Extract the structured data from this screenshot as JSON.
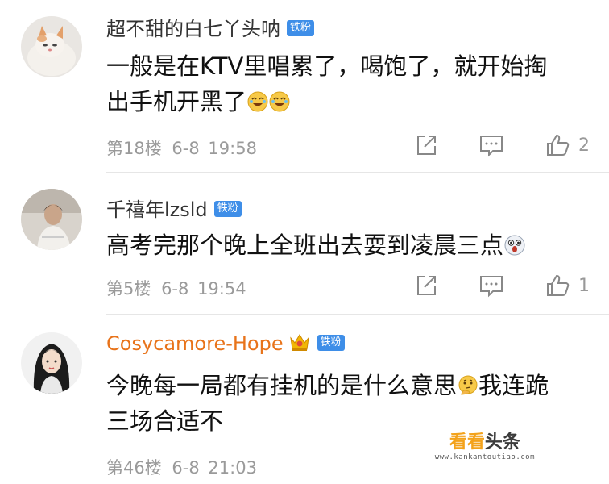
{
  "comments": [
    {
      "username": "超不甜的白七丫头呐",
      "badge": "铁粉",
      "text_line1": "一般是在KTV里唱累了，喝饱了，就开始掏",
      "text_line2": "出手机开黑了",
      "floor": "第18楼",
      "date": "6-8",
      "time": "19:58",
      "like_count": "2"
    },
    {
      "username": "千禧年lzsld",
      "badge": "铁粉",
      "text_line1": "高考完那个晚上全班出去耍到凌晨三点",
      "floor": "第5楼",
      "date": "6-8",
      "time": "19:54",
      "like_count": "1"
    },
    {
      "username": "Cosycamore-Hope",
      "badge": "铁粉",
      "text_line1": "今晚每一局都有挂机的是什么意思",
      "text_line1_after_emoji": "我连跪",
      "text_line2": "三场合适不",
      "floor": "第46楼",
      "date": "6-8",
      "time": "21:03"
    }
  ],
  "watermark": {
    "brand_part1": "看看",
    "brand_part2": "头条",
    "url": "www.kankantoutiao.com"
  },
  "colors": {
    "badge_blue": "#3e8ee8",
    "vip_name": "#e8731a",
    "meta_gray": "#9a9a9a"
  },
  "icons": [
    "share-icon",
    "comment-icon",
    "like-icon",
    "laughing-emoji",
    "shocked-emoji",
    "thinking-emoji",
    "crown-icon"
  ]
}
